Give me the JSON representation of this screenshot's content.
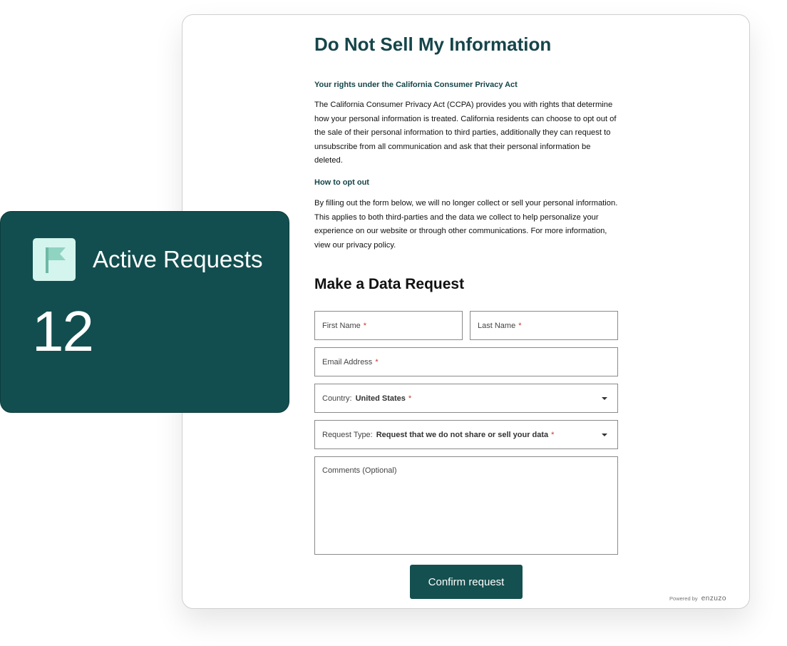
{
  "page": {
    "title": "Do Not Sell My Information",
    "rights_heading": "Your rights under the California Consumer Privacy Act",
    "rights_text": "The California Consumer Privacy Act (CCPA) provides you with rights that determine how your personal information is treated. California residents can choose to opt out of the sale of their personal information to third parties, additionally they can request to unsubscribe from all communication and ask that their personal information be deleted.",
    "optout_heading": "How to opt out",
    "optout_text": "By filling out the form below, we will no longer collect or sell your personal information. This applies to both third-parties and the data we collect to help personalize your experience on our website or through other communications. For more information, view our privacy policy."
  },
  "form": {
    "title": "Make a Data Request",
    "required_mark": "*",
    "first_name_label": "First Name",
    "last_name_label": "Last Name",
    "email_label": "Email Address",
    "country_label": "Country:",
    "country_value": "United States",
    "request_type_label": "Request Type:",
    "request_type_value": "Request that we do not share or sell your data",
    "comments_label": "Comments (Optional)",
    "confirm_label": "Confirm request"
  },
  "footer": {
    "powered_by": "Powered by",
    "brand": "enzuzo"
  },
  "stats": {
    "label": "Active Requests",
    "value": "12",
    "icon": "flag-icon"
  },
  "colors": {
    "brand_dark": "#14504f",
    "heading_teal": "#15454a",
    "icon_bg": "#d3f5ee",
    "required": "#c0392b"
  }
}
